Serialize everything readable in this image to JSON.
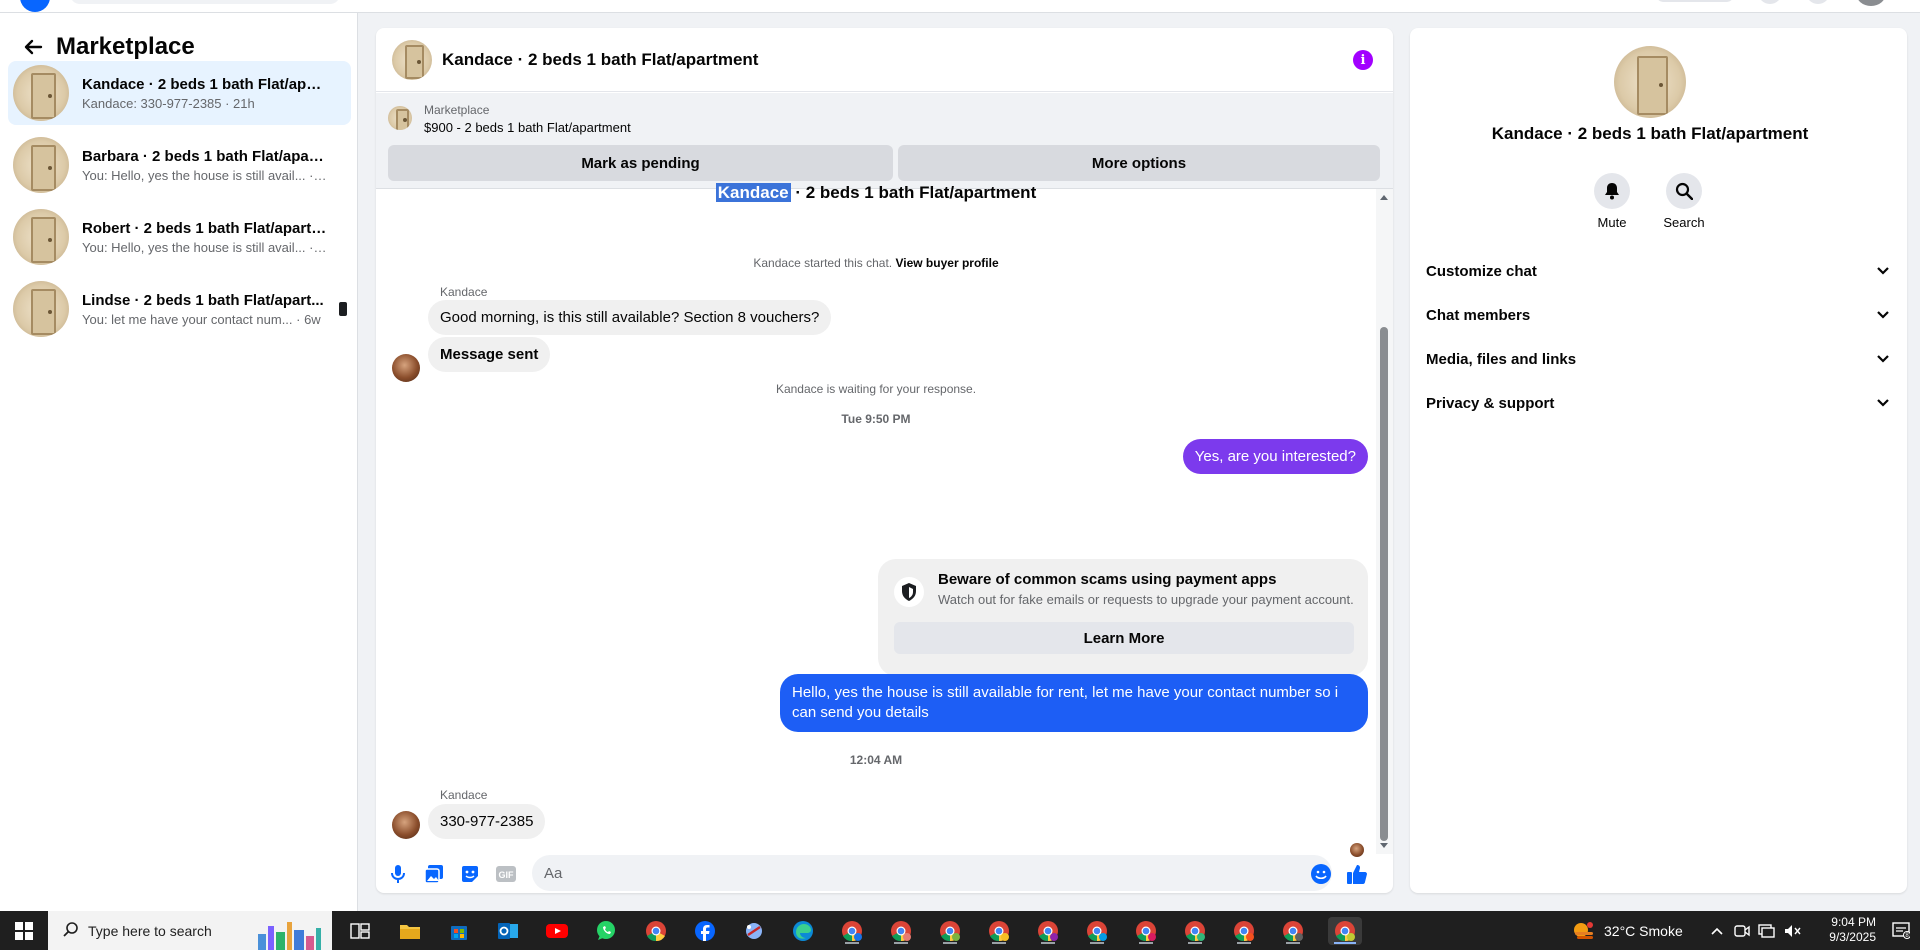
{
  "sidebar": {
    "title": "Marketplace",
    "conversations": [
      {
        "name": "Kandace · 2 beds 1 bath Flat/apart...",
        "sub": "Kandace: 330-977-2385 · 21h"
      },
      {
        "name": "Barbara · 2 beds 1 bath Flat/apart...",
        "sub": "You: Hello, yes the house is still avail... · 23h"
      },
      {
        "name": "Robert · 2 beds 1 bath Flat/apartm...",
        "sub": "You: Hello, yes the house is still avail... · 23h"
      },
      {
        "name": "Lindse · 2 beds 1 bath Flat/apart...",
        "sub": "You: let me have your contact num... · 6w"
      }
    ]
  },
  "chat": {
    "title": "Kandace · 2 beds 1 bath Flat/apartment",
    "listing": {
      "source": "Marketplace",
      "price_title": "$900 - 2 beds 1 bath Flat/apartment",
      "pending_label": "Mark as pending",
      "more_label": "More options"
    },
    "thread_title_highlight": "Kandace",
    "thread_title_rest": " · 2 beds 1 bath Flat/apartment",
    "started_note": "Kandace started this chat.",
    "view_profile": "View buyer profile",
    "sender1": "Kandace",
    "msg1": "Good morning, is this still available? Section 8 vouchers?",
    "msg2": "Message sent",
    "waiting_note": "Kandace is waiting for your response.",
    "time1": "Tue 9:50 PM",
    "out1": "Yes, are you interested?",
    "scam_title": "Beware of common scams using payment apps",
    "scam_desc": "Watch out for fake emails or requests to upgrade your payment account.",
    "learn_more": "Learn More",
    "out2": "Hello, yes the house is still available for rent, let me have your contact number so i can send you details",
    "time2": "12:04 AM",
    "sender2": "Kandace",
    "msg3": "330-977-2385",
    "composer_placeholder": "Aa"
  },
  "details": {
    "name": "Kandace · 2 beds 1 bath Flat/apartment",
    "mute": "Mute",
    "search": "Search",
    "rows": [
      "Customize chat",
      "Chat members",
      "Media, files and links",
      "Privacy & support"
    ]
  },
  "taskbar": {
    "search_placeholder": "Type here to search",
    "weather": "32°C  Smoke",
    "time": "9:04 PM",
    "date": "9/3/2025"
  },
  "colors": {
    "accent_blue": "#1d5ef5",
    "accent_purple": "#7c3aed",
    "info_purple": "#a200ff"
  }
}
